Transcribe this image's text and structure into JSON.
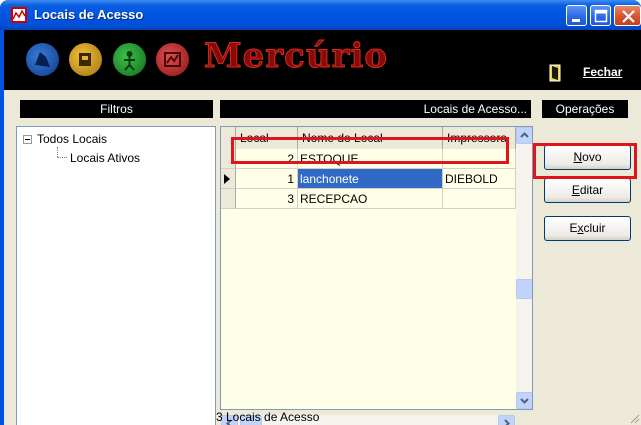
{
  "window": {
    "title": "Locais de Acesso",
    "controls": [
      "minimize",
      "maximize",
      "close"
    ]
  },
  "banner": {
    "logo_text": "Mercúrio",
    "icons": [
      "blue-app-icon",
      "yellow-app-icon",
      "green-app-icon",
      "red-app-icon"
    ],
    "fechar_label": "Fechar"
  },
  "panels": {
    "filtros_title": "Filtros",
    "locais_title": "Locais de Acesso...",
    "operacoes_title": "Operações"
  },
  "tree": {
    "root_label": "Todos Locais",
    "child_label": "Locais Ativos"
  },
  "grid": {
    "columns": [
      "Local",
      "Nome do Local",
      "Impressora"
    ],
    "rows": [
      {
        "local": "2",
        "nome": "ESTOQUE",
        "impressora": ""
      },
      {
        "local": "1",
        "nome": "lanchonete",
        "impressora": "DIEBOLD"
      },
      {
        "local": "3",
        "nome": "RECEPCAO",
        "impressora": ""
      }
    ],
    "selected_row_local": "1"
  },
  "operations": {
    "novo": {
      "pre": "",
      "key": "N",
      "post": "ovo"
    },
    "editar": {
      "pre": "",
      "key": "E",
      "post": "ditar"
    },
    "excluir": {
      "pre": "E",
      "key": "x",
      "post": "cluir"
    }
  },
  "status": {
    "text": "3 Locais de Acesso"
  },
  "colors": {
    "highlight": "#e0141c",
    "selection": "#316ac5",
    "grid_background": "#fffee6"
  }
}
